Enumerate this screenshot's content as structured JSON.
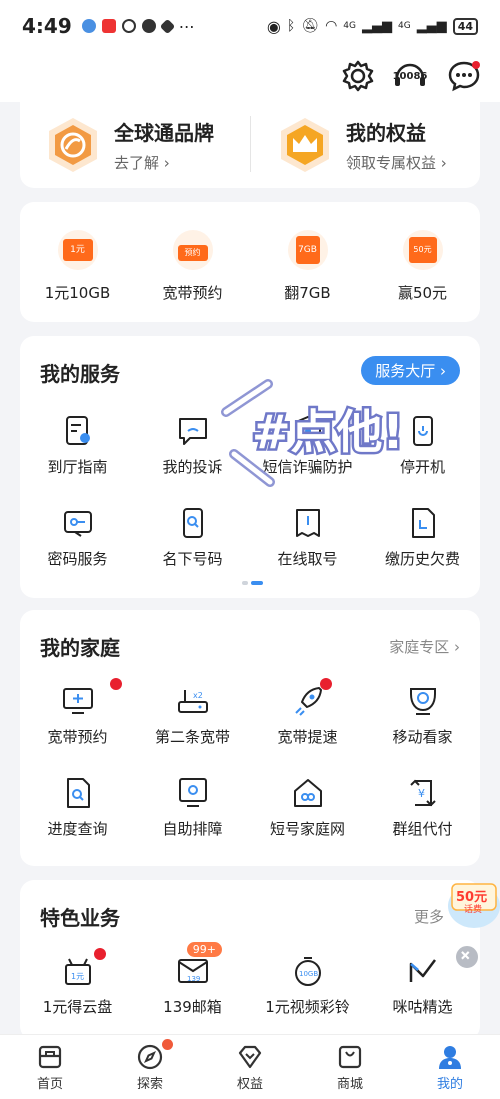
{
  "status": {
    "time": "4:49",
    "battery": "44",
    "net1": "4G",
    "net2": "4G"
  },
  "header": {
    "hotline": "10086"
  },
  "brand": [
    {
      "title": "全球通品牌",
      "sub": "去了解 ›",
      "icon": "globe-brand-icon"
    },
    {
      "title": "我的权益",
      "sub": "领取专属权益 ›",
      "icon": "crown-icon"
    }
  ],
  "promos": [
    {
      "label": "1元10GB",
      "tag": "1元"
    },
    {
      "label": "宽带预约",
      "tag": "预约"
    },
    {
      "label": "翻7GB",
      "tag": "7GB"
    },
    {
      "label": "赢50元",
      "tag": "50元"
    }
  ],
  "services": {
    "title": "我的服务",
    "hall_button": "服务大厅 ›",
    "items": [
      {
        "label": "到厅指南",
        "icon": "guide-doc-icon"
      },
      {
        "label": "我的投诉",
        "icon": "complaint-chat-icon"
      },
      {
        "label": "短信诈骗防护",
        "icon": "sms-shield-icon"
      },
      {
        "label": "停开机",
        "icon": "power-phone-icon"
      },
      {
        "label": "密码服务",
        "icon": "password-key-icon"
      },
      {
        "label": "名下号码",
        "icon": "number-search-icon"
      },
      {
        "label": "在线取号",
        "icon": "queue-ticket-icon"
      },
      {
        "label": "缴历史欠费",
        "icon": "bill-doc-icon"
      }
    ]
  },
  "stamp_text": "#点他!",
  "family": {
    "title": "我的家庭",
    "more": "家庭专区 ›",
    "items": [
      {
        "label": "宽带预约",
        "icon": "monitor-plus-icon",
        "dot": true
      },
      {
        "label": "第二条宽带",
        "icon": "router-icon",
        "dot": false
      },
      {
        "label": "宽带提速",
        "icon": "rocket-icon",
        "dot": true
      },
      {
        "label": "移动看家",
        "icon": "camera-icon",
        "dot": false
      },
      {
        "label": "进度查询",
        "icon": "doc-search-icon",
        "dot": false
      },
      {
        "label": "自助排障",
        "icon": "monitor-gear-icon",
        "dot": false
      },
      {
        "label": "短号家庭网",
        "icon": "home-link-icon",
        "dot": false
      },
      {
        "label": "群组代付",
        "icon": "yuan-card-icon",
        "dot": false
      }
    ]
  },
  "special": {
    "title": "特色业务",
    "more": "更多",
    "badge": "99+",
    "items": [
      {
        "label": "1元得云盘",
        "icon": "gift-yuan-icon",
        "dot": true
      },
      {
        "label": "139邮箱",
        "icon": "mail-139-icon",
        "dot": false
      },
      {
        "label": "1元视频彩铃",
        "icon": "timer-10gb-icon",
        "dot": false
      },
      {
        "label": "咪咕精选",
        "icon": "migu-icon",
        "dot": false
      }
    ]
  },
  "float_promo": {
    "amount": "50元",
    "sub": "话费"
  },
  "tabs": [
    {
      "label": "首页",
      "icon": "home-tab-icon",
      "active": false
    },
    {
      "label": "探索",
      "icon": "compass-tab-icon",
      "active": false
    },
    {
      "label": "权益",
      "icon": "diamond-tab-icon",
      "active": false
    },
    {
      "label": "商城",
      "icon": "bag-tab-icon",
      "active": false
    },
    {
      "label": "我的",
      "icon": "profile-tab-icon",
      "active": true
    }
  ],
  "colors": {
    "accent": "#3a8ef0",
    "red": "#e8202e",
    "orange": "#ff6a1a",
    "gold": "#f5a623"
  }
}
